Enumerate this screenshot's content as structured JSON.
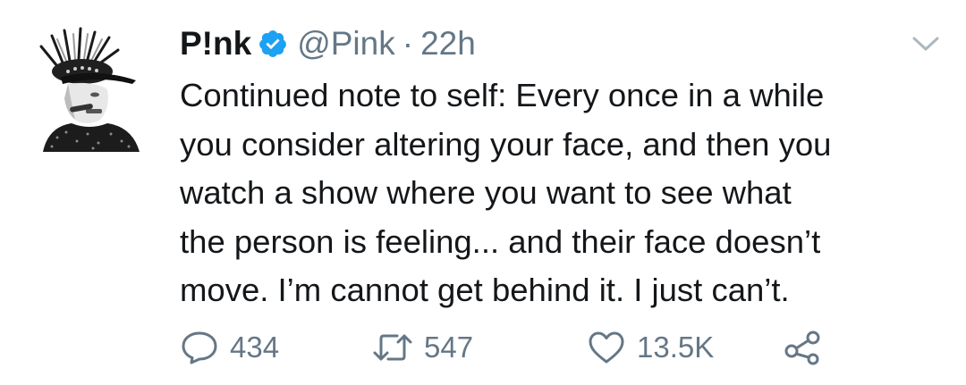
{
  "tweet": {
    "display_name": "P!nk",
    "handle": "@Pink",
    "separator": "·",
    "time": "22h",
    "text": "Continued note to self: Every once in a while\nyou consider altering your face, and then you\nwatch a show where you want to see what\nthe person is feeling... and their face doesn’t\nmove. I’m cannot get behind it. I just can’t.",
    "verified": true
  },
  "actions": {
    "reply": {
      "icon": "reply-icon",
      "count": "434"
    },
    "retweet": {
      "icon": "retweet-icon",
      "count": "547"
    },
    "like": {
      "icon": "heart-icon",
      "count": "13.5K"
    },
    "share": {
      "icon": "share-icon"
    }
  },
  "colors": {
    "text": "#14171a",
    "secondary": "#657786",
    "verified_blue": "#1da1f2",
    "background": "#ffffff"
  }
}
